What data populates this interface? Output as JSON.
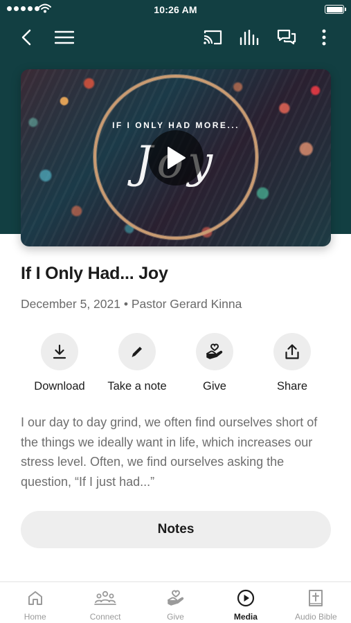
{
  "status_bar": {
    "time": "10:26 AM"
  },
  "nav": {
    "icons": [
      "back-icon",
      "menu-icon",
      "cast-icon",
      "audio-bars-icon",
      "chat-icon",
      "more-vertical-icon"
    ]
  },
  "hero": {
    "overlay_title": "IF I ONLY HAD MORE...",
    "script_word": "Joy"
  },
  "sermon": {
    "title": "If I Only Had... Joy",
    "meta": "December 5, 2021 • Pastor Gerard Kinna",
    "description": "I our day to day grind, we often find ourselves short of the things we ideally want in life, which increases our stress level. Often, we find ourselves asking the question, “If I just had...”"
  },
  "actions": [
    {
      "label": "Download",
      "icon": "download-icon"
    },
    {
      "label": "Take a note",
      "icon": "pencil-icon"
    },
    {
      "label": "Give",
      "icon": "give-hand-heart-icon"
    },
    {
      "label": "Share",
      "icon": "share-icon"
    }
  ],
  "notes_button": {
    "label": "Notes"
  },
  "tab_bar": {
    "active": "Media",
    "tabs": [
      {
        "label": "Home",
        "icon": "home-icon"
      },
      {
        "label": "Connect",
        "icon": "people-icon"
      },
      {
        "label": "Give",
        "icon": "give-hand-heart-icon"
      },
      {
        "label": "Media",
        "icon": "play-circle-icon"
      },
      {
        "label": "Audio Bible",
        "icon": "bible-icon"
      }
    ]
  },
  "colors": {
    "header_bg": "#123f42",
    "text_primary": "#1b1b1b",
    "text_secondary": "#6a6a6a",
    "chip_bg": "#ededed",
    "tab_inactive": "#9a9a9a"
  }
}
